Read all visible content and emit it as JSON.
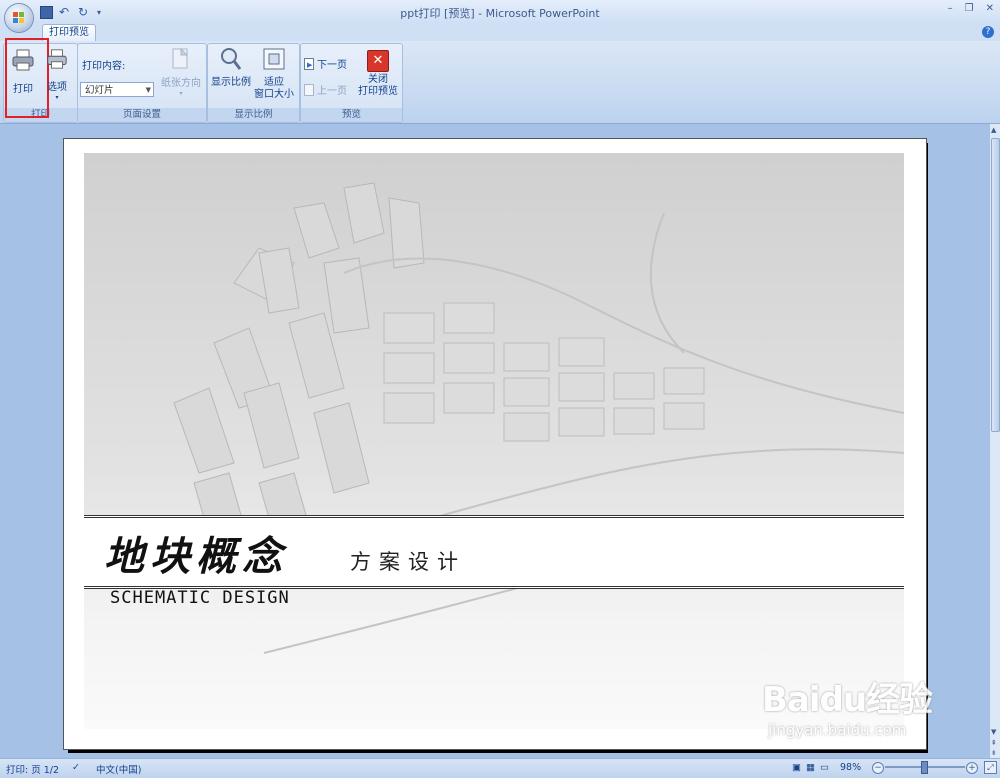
{
  "window": {
    "title": "ppt打印 [预览] - Microsoft PowerPoint",
    "minimize": "–",
    "restore": "❐",
    "close": "✕",
    "help": "?"
  },
  "ribbon": {
    "tab_label": "打印预览",
    "groups": {
      "print": {
        "label": "打印",
        "print_button": "打印",
        "options_button": "选项"
      },
      "page_setup": {
        "label": "页面设置",
        "content_label": "打印内容:",
        "content_value": "幻灯片",
        "orientation_button": "纸张方向"
      },
      "zoom": {
        "label": "显示比例",
        "zoom_button": "显示比例",
        "fit_button_line1": "适应",
        "fit_button_line2": "窗口大小"
      },
      "preview": {
        "label": "预览",
        "next_page": "下一页",
        "prev_page": "上一页",
        "close_line1": "关闭",
        "close_line2": "打印预览"
      }
    }
  },
  "slide": {
    "title_cn": "地块概念",
    "subtitle_cn": "方案设计",
    "subtitle_en": "SCHEMATIC DESIGN"
  },
  "watermark": {
    "main": "Baidu经验",
    "url": "jingyan.baidu.com"
  },
  "status": {
    "page": "打印: 页 1/2",
    "language": "中文(中国)",
    "zoom": "98%"
  },
  "colors": {
    "ribbon_text": "#15428b",
    "highlight": "#e0202a",
    "close_icon": "#d9362b"
  },
  "icons": [
    "office-button-icon",
    "save-icon",
    "undo-icon",
    "redo-icon",
    "printer-icon",
    "page-icon",
    "magnifier-icon",
    "fit-window-icon",
    "arrow-icon",
    "close-icon"
  ]
}
